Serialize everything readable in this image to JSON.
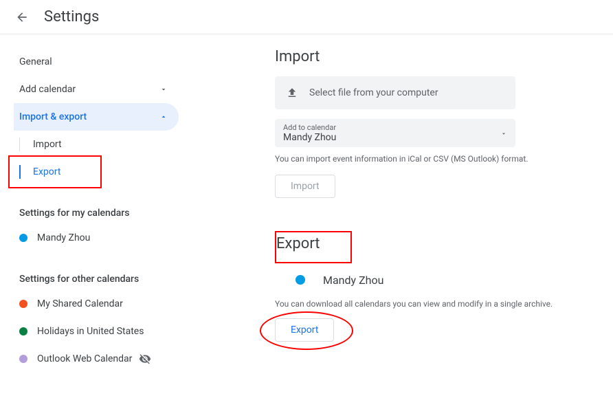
{
  "header": {
    "title": "Settings"
  },
  "sidebar": {
    "general": "General",
    "addCalendar": "Add calendar",
    "importExport": "Import & export",
    "subImport": "Import",
    "subExport": "Export",
    "myCalHeading": "Settings for my calendars",
    "otherCalHeading": "Settings for other calendars",
    "myCals": [
      {
        "name": "Mandy Zhou",
        "color": "#039be5"
      }
    ],
    "otherCals": [
      {
        "name": "My Shared Calendar",
        "color": "#f4511e"
      },
      {
        "name": "Holidays in United States",
        "color": "#0b8043"
      },
      {
        "name": "Outlook Web Calendar",
        "color": "#b39ddb",
        "hidden": true
      }
    ]
  },
  "importSection": {
    "title": "Import",
    "selectFile": "Select file from your computer",
    "dropdownLabel": "Add to calendar",
    "dropdownValue": "Mandy Zhou",
    "hint": "You can import event information in iCal or CSV (MS Outlook) format.",
    "button": "Import"
  },
  "exportSection": {
    "title": "Export",
    "calName": "Mandy Zhou",
    "calColor": "#039be5",
    "hint": "You can download all calendars you can view and modify in a single archive.",
    "button": "Export"
  }
}
